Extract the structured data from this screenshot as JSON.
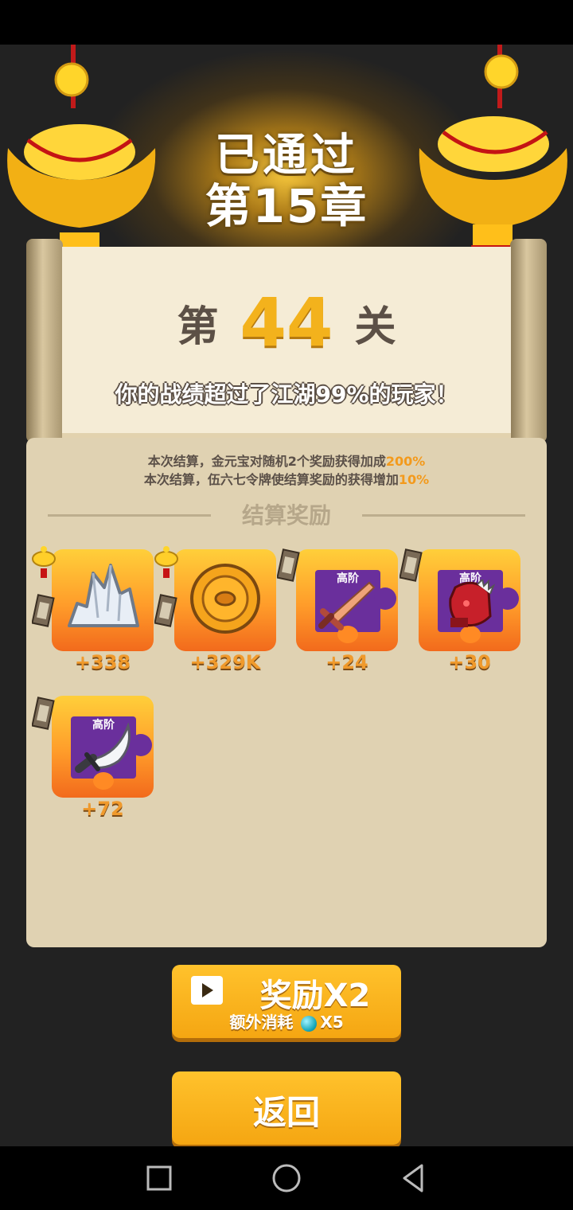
{
  "header": {
    "title_line1": "已通过",
    "title_line2": "第15章"
  },
  "level": {
    "prefix": "第",
    "number": "44",
    "suffix": "关"
  },
  "record_text": "你的战绩超过了江湖99%的玩家！",
  "bonus": {
    "line1_text": "本次结算，金元宝对随机2个奖励获得加成",
    "line1_value": "200%",
    "line2_text": "本次结算，伍六七令牌使结算奖励的获得增加",
    "line2_value": "10%"
  },
  "section_title": "结算奖励",
  "rewards": [
    {
      "amount": "+338",
      "icon": "silver-ore-icon"
    },
    {
      "amount": "+329K",
      "icon": "gold-coin-icon"
    },
    {
      "amount": "+24",
      "tier": "高阶",
      "icon": "sword-icon"
    },
    {
      "amount": "+30",
      "tier": "高阶",
      "icon": "gauntlet-icon"
    },
    {
      "amount": "+72",
      "tier": "高阶",
      "icon": "dagger-icon"
    }
  ],
  "buttons": {
    "double_label": "奖励X2",
    "extra_cost_label": "额外消耗",
    "extra_cost_amount": "X5",
    "back_label": "返回"
  },
  "colors": {
    "accent": "#f5a612",
    "highlight": "#f39a1c",
    "panel": "#e0d2b2"
  }
}
